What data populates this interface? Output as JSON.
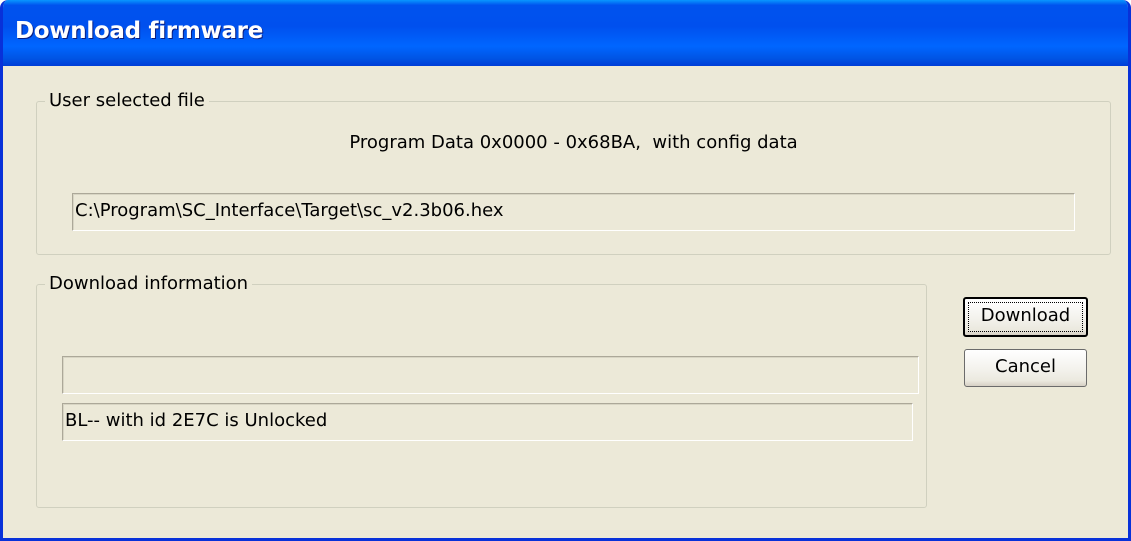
{
  "window": {
    "title": "Download firmware"
  },
  "user_selected_file": {
    "group_label": "User selected file",
    "program_info": "Program Data 0x0000 - 0x68BA,  with config data",
    "file_path": "C:\\Program\\SC_Interface\\Target\\sc_v2.3b06.hex"
  },
  "download_information": {
    "group_label": "Download information",
    "progress": 0,
    "status_text": "BL-- with id 2E7C is Unlocked"
  },
  "buttons": {
    "download_label": "Download",
    "cancel_label": "Cancel"
  },
  "colors": {
    "titlebar": "#0054e3",
    "dialog_face": "#ece9d8"
  }
}
